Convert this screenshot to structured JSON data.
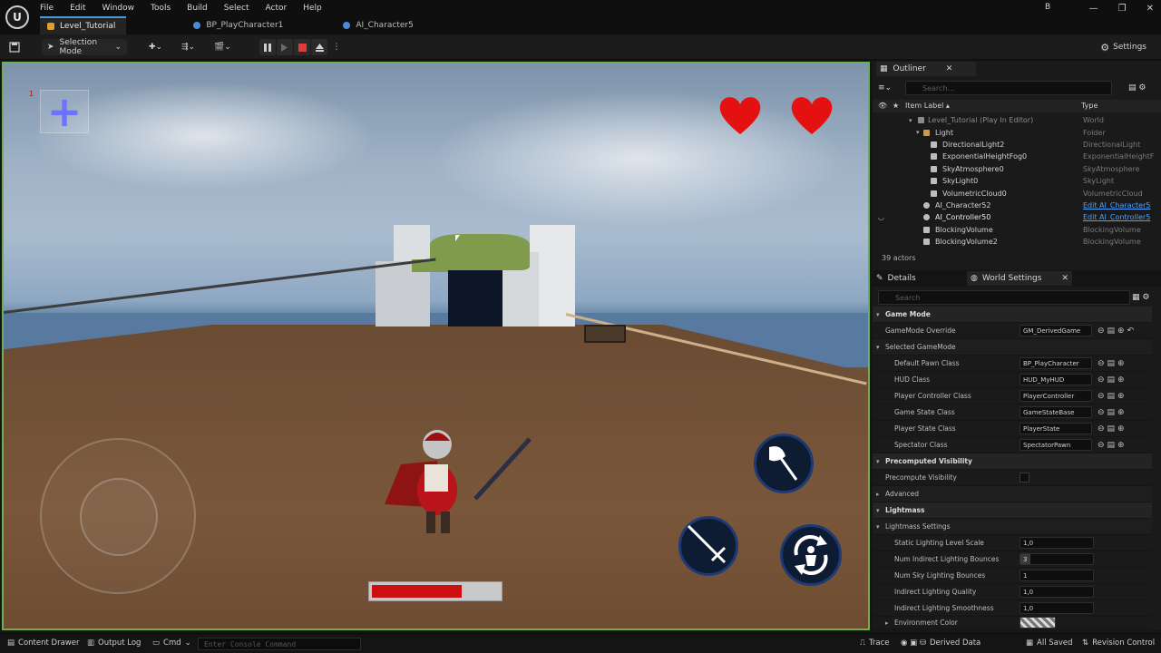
{
  "app": {
    "menus": [
      "File",
      "Edit",
      "Window",
      "Tools",
      "Build",
      "Select",
      "Actor",
      "Help"
    ],
    "tabs": [
      "Level_Tutorial",
      "BP_PlayCharacter1",
      "AI_Character5"
    ],
    "user_badge": "B",
    "window_controls": [
      "—",
      "❐",
      "✕"
    ]
  },
  "toolbar": {
    "selection_mode": "Selection Mode",
    "settings": "Settings"
  },
  "viewport": {
    "counter": "1",
    "hearts": 2,
    "health_fraction": 0.7,
    "accent": "#6fae55"
  },
  "outliner": {
    "tab": "Outliner",
    "search_placeholder": "Search...",
    "col_label": "Item Label ▴",
    "col_type": "Type",
    "rows": [
      {
        "label": "Level_Tutorial (Play In Editor)",
        "type": "World"
      },
      {
        "label": "Light",
        "type": "Folder"
      },
      {
        "label": "DirectionalLight2",
        "type": "DirectionalLight"
      },
      {
        "label": "ExponentialHeightFog0",
        "type": "ExponentialHeightF"
      },
      {
        "label": "SkyAtmosphere0",
        "type": "SkyAtmosphere"
      },
      {
        "label": "SkyLight0",
        "type": "SkyLight"
      },
      {
        "label": "VolumetricCloud0",
        "type": "VolumetricCloud"
      },
      {
        "label": "AI_Character52",
        "type": "Edit AI_Character5"
      },
      {
        "label": "AI_Controller50",
        "type": "Edit AI_Controller5"
      },
      {
        "label": "BlockingVolume",
        "type": "BlockingVolume"
      },
      {
        "label": "BlockingVolume2",
        "type": "BlockingVolume"
      }
    ],
    "actor_count": "39 actors"
  },
  "details": {
    "tab_details": "Details",
    "tab_world": "World Settings",
    "search_placeholder": "Search",
    "rows": [
      {
        "kind": "section",
        "name": "Game Mode"
      },
      {
        "kind": "prop",
        "name": "GameMode Override",
        "value": "GM_DerivedGame"
      },
      {
        "kind": "sub",
        "name": "Selected GameMode"
      },
      {
        "kind": "prop",
        "name": "Default Pawn Class",
        "value": "BP_PlayCharacter"
      },
      {
        "kind": "prop",
        "name": "HUD Class",
        "value": "HUD_MyHUD"
      },
      {
        "kind": "prop",
        "name": "Player Controller Class",
        "value": "PlayerController"
      },
      {
        "kind": "prop",
        "name": "Game State Class",
        "value": "GameStateBase"
      },
      {
        "kind": "prop",
        "name": "Player State Class",
        "value": "PlayerState"
      },
      {
        "kind": "prop",
        "name": "Spectator Class",
        "value": "SpectatorPawn"
      },
      {
        "kind": "section",
        "name": "Precomputed Visibility"
      },
      {
        "kind": "check",
        "name": "Precompute Visibility"
      },
      {
        "kind": "sub",
        "name": "Advanced"
      },
      {
        "kind": "section",
        "name": "Lightmass"
      },
      {
        "kind": "sub",
        "name": "Lightmass Settings"
      },
      {
        "kind": "num",
        "name": "Static Lighting Level Scale",
        "value": "1,0"
      },
      {
        "kind": "num",
        "name": "Num Indirect Lighting Bounces",
        "value": "3"
      },
      {
        "kind": "num",
        "name": "Num Sky Lighting Bounces",
        "value": "1"
      },
      {
        "kind": "num",
        "name": "Indirect Lighting Quality",
        "value": "1,0"
      },
      {
        "kind": "num",
        "name": "Indirect Lighting Smoothness",
        "value": "1,0"
      },
      {
        "kind": "sub",
        "name": "Environment Color"
      }
    ]
  },
  "statusbar": {
    "content_drawer": "Content Drawer",
    "output_log": "Output Log",
    "cmd": "Cmd",
    "console_placeholder": "Enter Console Command",
    "trace": "Trace",
    "derived_data": "Derived Data",
    "all_saved": "All Saved",
    "revision_control": "Revision Control"
  }
}
